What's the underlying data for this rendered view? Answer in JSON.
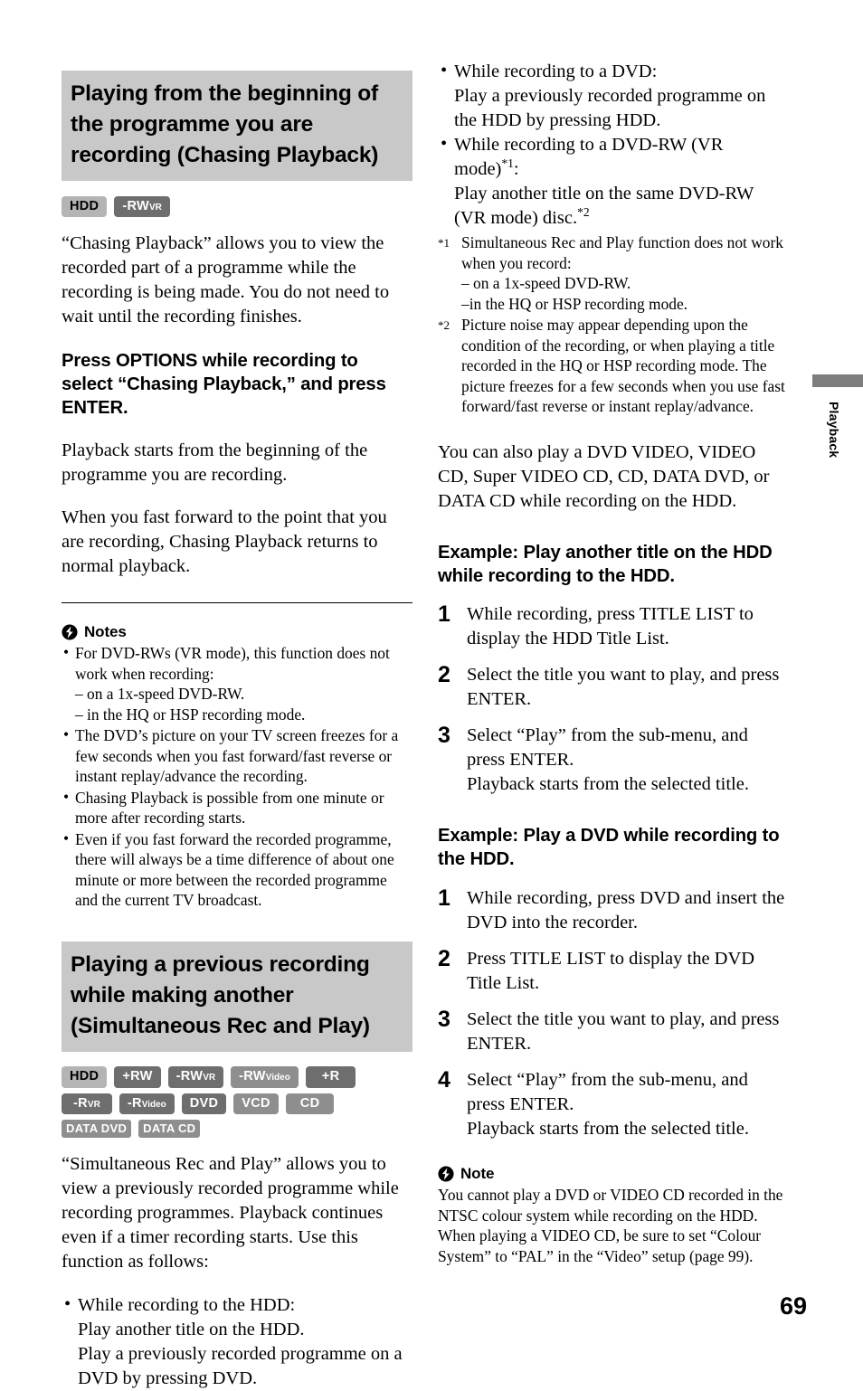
{
  "page": {
    "number": "69",
    "thumb_tab_label": "Playback"
  },
  "colors": {
    "heading_band": "#c8c8c8",
    "badge_light": "#b4b4b4",
    "badge_mid": "#8e8e8e",
    "badge_dark": "#6e6e6e",
    "thumb_bar": "#7d7d7d"
  },
  "left_column": {
    "section1": {
      "heading": "Playing from the beginning of the programme you are recording (Chasing Playback)",
      "badges": [
        {
          "label": "HDD",
          "style": "light"
        },
        {
          "label": "-RW",
          "sub": "VR",
          "style": "dark"
        }
      ],
      "intro": "“Chasing Playback” allows you to view the recorded part of a programme while the recording is being made. You do not need to wait until the recording finishes.",
      "bold_step": "Press OPTIONS while recording to select “Chasing Playback,” and press ENTER.",
      "para1": "Playback starts from the beginning of the programme you are recording.",
      "para2": "When you fast forward to the point that you are recording, Chasing Playback returns to normal playback.",
      "notes_title": "Notes",
      "notes": [
        {
          "text": "For DVD-RWs (VR mode), this function does not work when recording:",
          "subs": [
            "– on a 1x-speed DVD-RW.",
            "– in the HQ or HSP recording mode."
          ]
        },
        {
          "text": "The DVD’s picture on your TV screen freezes for a few seconds when you fast forward/fast reverse or instant replay/advance the recording.",
          "subs": []
        },
        {
          "text": "Chasing Playback is possible from one minute or more after recording starts.",
          "subs": []
        },
        {
          "text": "Even if you fast forward the recorded programme, there will always be a time difference of about one minute or more between the recorded programme and the current TV broadcast.",
          "subs": []
        }
      ]
    },
    "section2": {
      "heading": "Playing a previous recording while making another (Simultaneous Rec and Play)",
      "badges": [
        {
          "label": "HDD",
          "style": "light"
        },
        {
          "label": "+RW",
          "style": "dark"
        },
        {
          "label": "-RW",
          "sub": "VR",
          "style": "dark"
        },
        {
          "label": "-RW",
          "sub": "Video",
          "style": "mid"
        },
        {
          "label": "+R",
          "style": "dark"
        },
        {
          "label": "-R",
          "sub": "VR",
          "style": "dark"
        },
        {
          "label": "-R",
          "sub": "Video",
          "style": "dark"
        },
        {
          "label": "DVD",
          "style": "dark"
        },
        {
          "label": "VCD",
          "style": "light-w"
        },
        {
          "label": "CD",
          "style": "light-w"
        },
        {
          "label": "DATA DVD",
          "style": "data"
        },
        {
          "label": "DATA CD",
          "style": "data"
        }
      ],
      "intro": "“Simultaneous Rec and Play” allows you to view a previously recorded programme while recording programmes. Playback continues even if a timer recording starts. Use this function as follows:",
      "bullets": [
        {
          "text": "While recording to the HDD:",
          "lines": [
            "Play another title on the HDD.",
            "Play a previously recorded programme on a DVD by pressing DVD."
          ]
        }
      ]
    }
  },
  "right_column": {
    "bullets": [
      {
        "text": "While recording to a DVD:",
        "lines": [
          "Play a previously recorded programme on the HDD by pressing HDD."
        ]
      },
      {
        "text": "While recording to a DVD-RW (VR mode)",
        "ref": "*1",
        "text_after": ":",
        "lines": [
          "Play another title on the same DVD-RW (VR mode) disc."
        ],
        "line_ref": "*2"
      }
    ],
    "footnotes": [
      {
        "mark": "*1",
        "text": "Simultaneous Rec and Play function does not work when you record:",
        "dashes": [
          "– on a 1x-speed DVD-RW.",
          "–in the HQ or HSP recording mode."
        ]
      },
      {
        "mark": "*2",
        "text": "Picture noise may appear depending upon the condition of the recording, or when playing a title recorded in the HQ or HSP recording mode. The picture freezes for a few seconds when you use fast forward/fast reverse or instant replay/advance.",
        "dashes": []
      }
    ],
    "also_para": "You can also play a DVD VIDEO, VIDEO CD, Super VIDEO CD, CD, DATA DVD, or DATA CD while recording on the HDD.",
    "example1": {
      "heading": "Example: Play another title on the HDD while recording to the HDD.",
      "steps": [
        {
          "num": "1",
          "text": "While recording, press TITLE LIST to display the HDD Title List.",
          "extra": ""
        },
        {
          "num": "2",
          "text": "Select the title you want to play, and press ENTER.",
          "extra": ""
        },
        {
          "num": "3",
          "text": "Select “Play” from the sub-menu, and press ENTER.",
          "extra": "Playback starts from the selected title."
        }
      ]
    },
    "example2": {
      "heading": "Example: Play a DVD while recording to the HDD.",
      "steps": [
        {
          "num": "1",
          "text": "While recording, press DVD and insert the DVD into the recorder.",
          "extra": ""
        },
        {
          "num": "2",
          "text": "Press TITLE LIST to display the DVD Title List.",
          "extra": ""
        },
        {
          "num": "3",
          "text": "Select the title you want to play, and press ENTER.",
          "extra": ""
        },
        {
          "num": "4",
          "text": "Select “Play” from the sub-menu, and press ENTER.",
          "extra": "Playback starts from the selected title."
        }
      ]
    },
    "note_title": "Note",
    "note_text": "You cannot play a DVD or VIDEO CD recorded in the NTSC colour system while recording on the HDD. When playing a VIDEO CD, be sure to set “Colour System” to “PAL” in the “Video” setup (page 99)."
  }
}
